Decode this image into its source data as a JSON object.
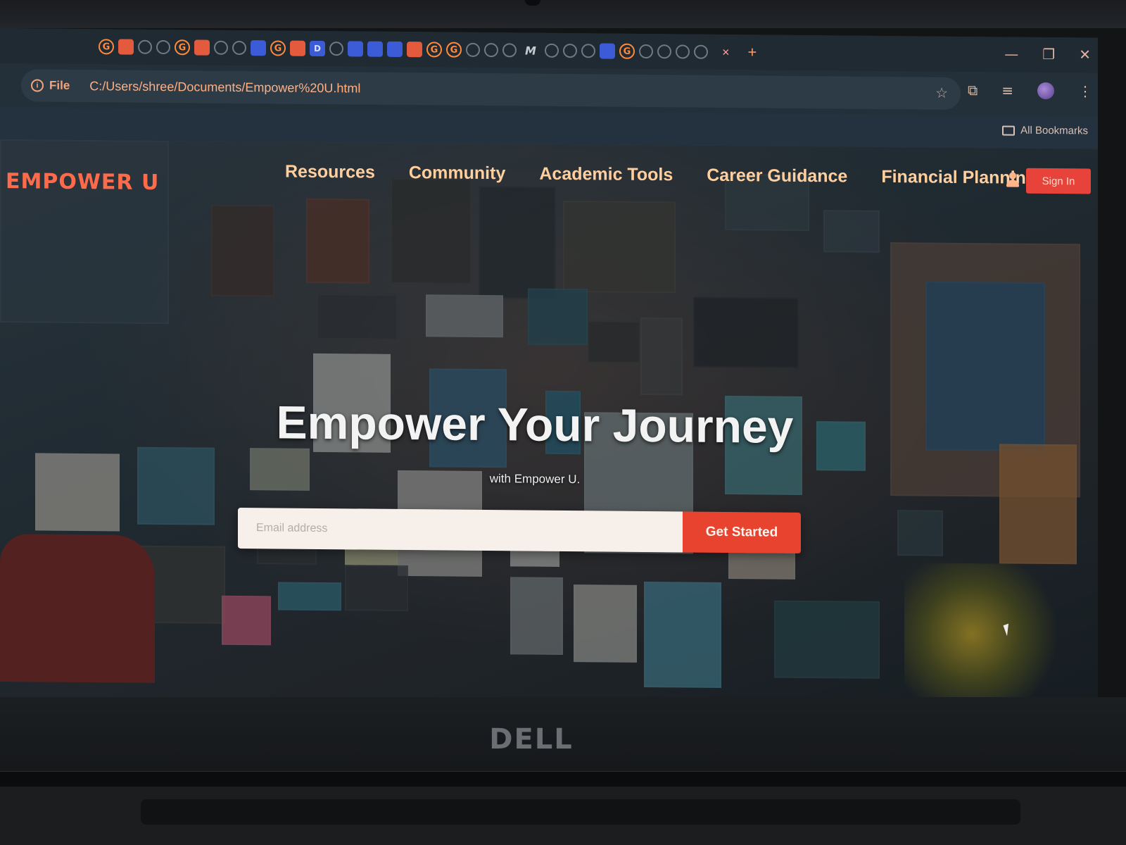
{
  "browser": {
    "tabs": {
      "icons": [
        "G",
        "",
        "",
        "",
        "G",
        "",
        "",
        "",
        "",
        "G",
        "",
        "D",
        "",
        "",
        "",
        "",
        "",
        "G",
        "G",
        "",
        "",
        "",
        "M",
        "",
        "",
        "",
        "",
        "G",
        "",
        "",
        "",
        ""
      ],
      "close_glyph": "×",
      "new_tab_glyph": "+"
    },
    "window_controls": [
      "—",
      "❐",
      "✕"
    ],
    "address": {
      "chip_label": "File",
      "url": "C:/Users/shree/Documents/Empower%20U.html"
    },
    "bookmarks": {
      "all_label": "All Bookmarks"
    }
  },
  "device": {
    "brand": "DELL"
  },
  "site": {
    "logo": "EMPOWER U",
    "nav": [
      "Resources",
      "Community",
      "Academic Tools",
      "Career Guidance",
      "Financial Planning"
    ],
    "signin_label": "Sign In",
    "hero": {
      "title": "Empower Your Journey",
      "subtitle": "with Empower U."
    },
    "signup": {
      "placeholder": "Email address",
      "button_label": "Get Started"
    }
  },
  "colors": {
    "accent": "#e8433a",
    "nav_text": "#ffcf9f",
    "logo": "#ff6b4a"
  }
}
